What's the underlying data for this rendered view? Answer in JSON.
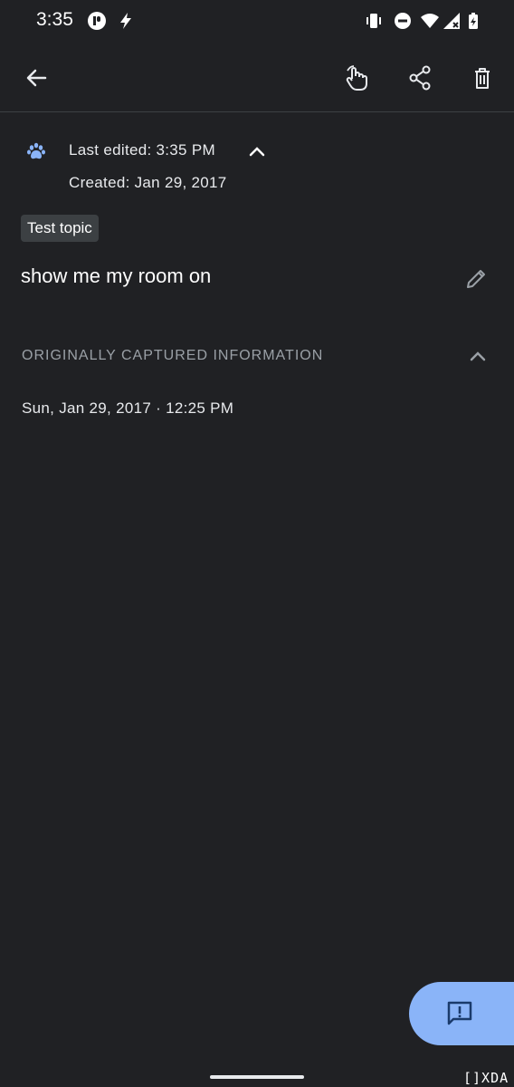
{
  "status_bar": {
    "time": "3:35",
    "icons": [
      "app-notification-icon",
      "bolt-icon",
      "vibrate-icon",
      "do-not-disturb-icon",
      "wifi-icon",
      "cell-signal-icon",
      "battery-charging-icon"
    ]
  },
  "toolbar": {
    "back_icon": "arrow-back-icon",
    "actions": [
      "feedback-hand-icon",
      "share-icon",
      "delete-icon"
    ]
  },
  "meta": {
    "last_edited": "Last edited: 3:35 PM",
    "created": "Created: Jan 29, 2017"
  },
  "topic_chip": "Test topic",
  "query": "show me my room on",
  "captured_section": {
    "header": "ORIGINALLY CAPTURED INFORMATION",
    "date": "Sun, Jan 29, 2017 · 12:25 PM"
  },
  "fab_icon": "feedback-icon",
  "watermark": "[]XDA",
  "colors": {
    "background": "#202124",
    "accent": "#8ab4f8",
    "chip_bg": "#3c4043",
    "secondary_text": "#9aa0a6"
  }
}
